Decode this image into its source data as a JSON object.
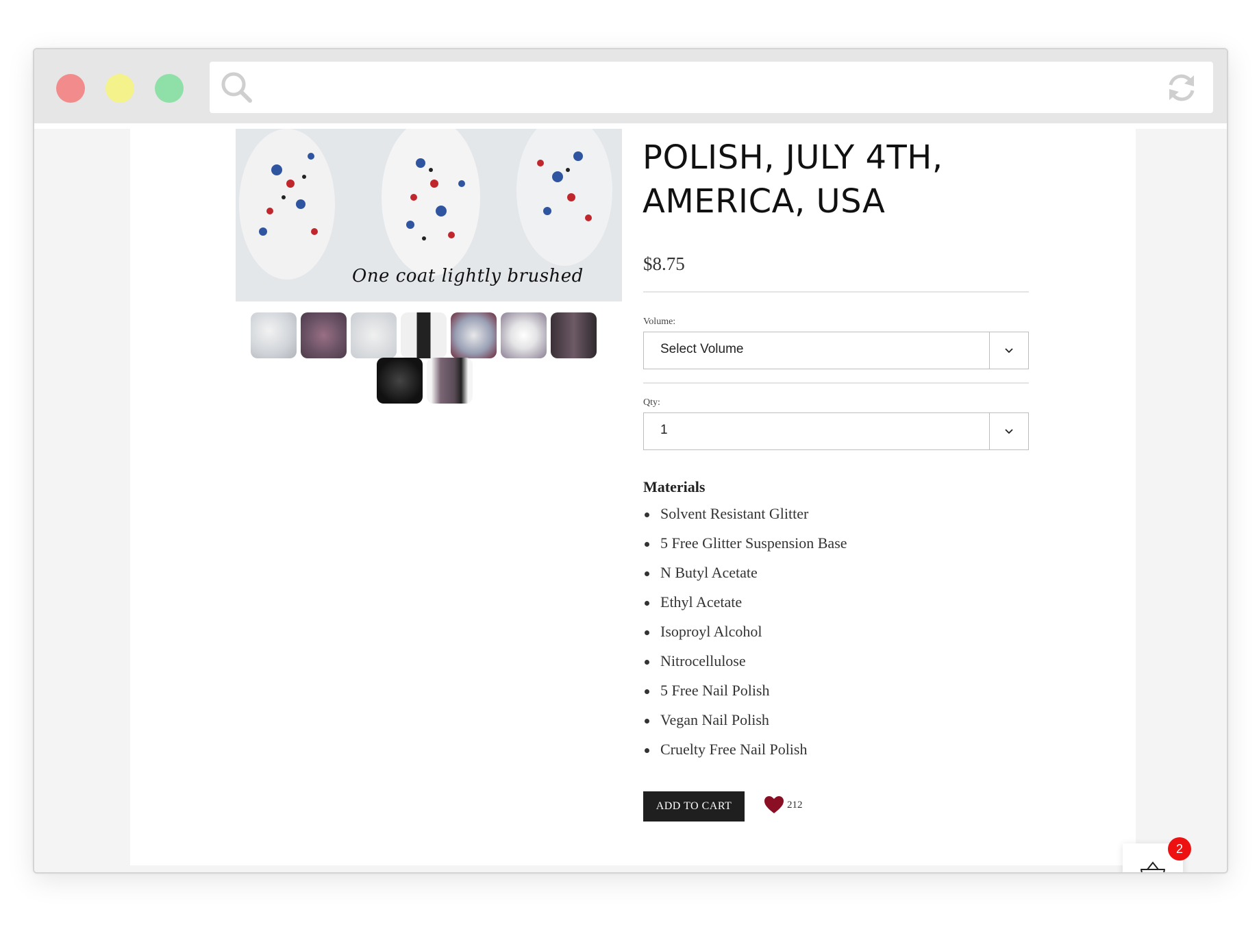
{
  "product": {
    "title_line1": "POLISH, JULY 4TH,",
    "title_line2": "AMERICA, USA",
    "price": "$8.75",
    "image_caption": "One coat lightly brushed"
  },
  "volume": {
    "label": "Volume:",
    "selected": "Select Volume"
  },
  "qty": {
    "label": "Qty:",
    "selected": "1"
  },
  "materials": {
    "title": "Materials",
    "items": [
      "Solvent Resistant Glitter",
      "5 Free Glitter Suspension Base",
      "N Butyl Acetate",
      "Ethyl Acetate",
      "Isoproyl Alcohol",
      "Nitrocellulose",
      "5 Free Nail Polish",
      "Vegan Nail Polish",
      "Cruelty Free Nail Polish"
    ]
  },
  "actions": {
    "add_to_cart": "ADD TO CART",
    "favorites_count": "212"
  },
  "cart": {
    "badge_count": "2"
  },
  "colors": {
    "heart": "#8a0f24",
    "badge": "#ee1111",
    "button": "#1f1f1f"
  },
  "icons": [
    "search-icon",
    "reload-icon",
    "chevron-down-icon",
    "heart-icon",
    "basket-icon"
  ]
}
